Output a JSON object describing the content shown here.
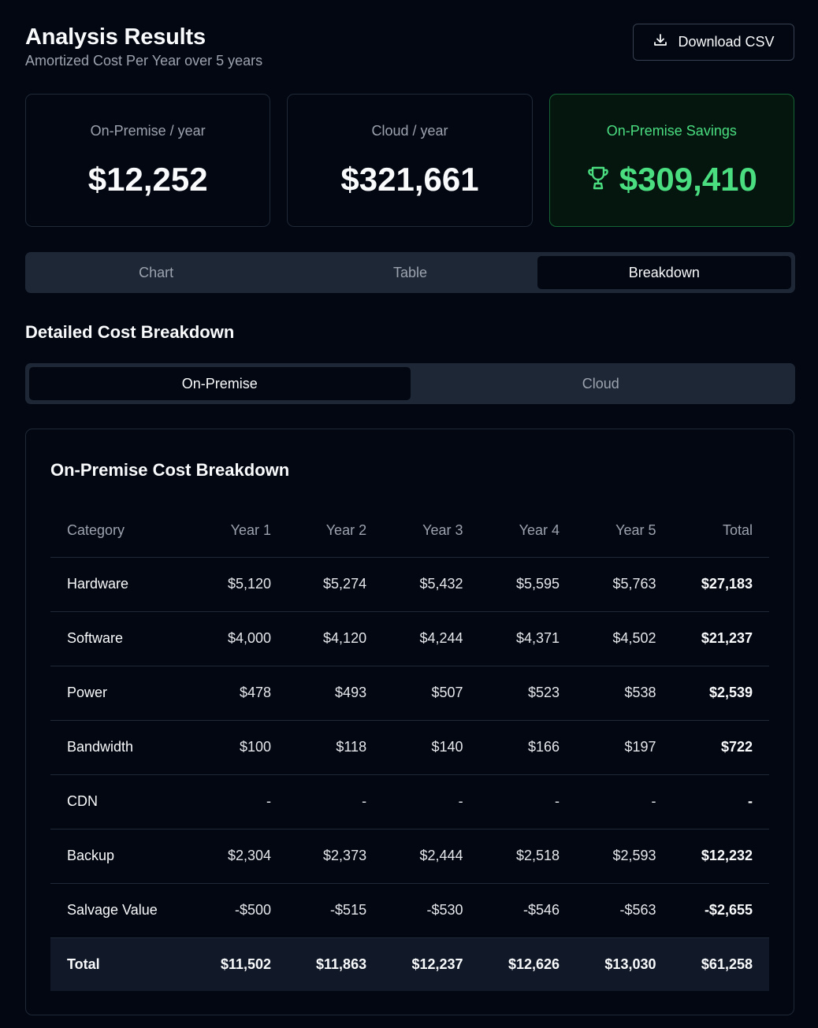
{
  "header": {
    "title": "Analysis Results",
    "subtitle": "Amortized Cost Per Year over 5 years",
    "download_label": "Download CSV"
  },
  "cards": {
    "onprem": {
      "label": "On-Premise / year",
      "value": "$12,252"
    },
    "cloud": {
      "label": "Cloud / year",
      "value": "$321,661"
    },
    "savings": {
      "label": "On-Premise Savings",
      "value": "$309,410",
      "icon": "trophy-icon"
    }
  },
  "tabs": [
    {
      "label": "Chart",
      "active": false
    },
    {
      "label": "Table",
      "active": false
    },
    {
      "label": "Breakdown",
      "active": true
    }
  ],
  "section_title": "Detailed Cost Breakdown",
  "subtabs": [
    {
      "label": "On-Premise",
      "active": true
    },
    {
      "label": "Cloud",
      "active": false
    }
  ],
  "breakdown": {
    "title": "On-Premise Cost Breakdown",
    "columns": [
      "Category",
      "Year 1",
      "Year 2",
      "Year 3",
      "Year 4",
      "Year 5",
      "Total"
    ],
    "rows": [
      [
        "Hardware",
        "$5,120",
        "$5,274",
        "$5,432",
        "$5,595",
        "$5,763",
        "$27,183"
      ],
      [
        "Software",
        "$4,000",
        "$4,120",
        "$4,244",
        "$4,371",
        "$4,502",
        "$21,237"
      ],
      [
        "Power",
        "$478",
        "$493",
        "$507",
        "$523",
        "$538",
        "$2,539"
      ],
      [
        "Bandwidth",
        "$100",
        "$118",
        "$140",
        "$166",
        "$197",
        "$722"
      ],
      [
        "CDN",
        "-",
        "-",
        "-",
        "-",
        "-",
        "-"
      ],
      [
        "Backup",
        "$2,304",
        "$2,373",
        "$2,444",
        "$2,518",
        "$2,593",
        "$12,232"
      ],
      [
        "Salvage Value",
        "-$500",
        "-$515",
        "-$530",
        "-$546",
        "-$563",
        "-$2,655"
      ]
    ],
    "total_row": [
      "Total",
      "$11,502",
      "$11,863",
      "$12,237",
      "$12,626",
      "$13,030",
      "$61,258"
    ]
  },
  "colors": {
    "background": "#030712",
    "accent_green": "#4ade80",
    "tab_bg": "#1e2736"
  }
}
